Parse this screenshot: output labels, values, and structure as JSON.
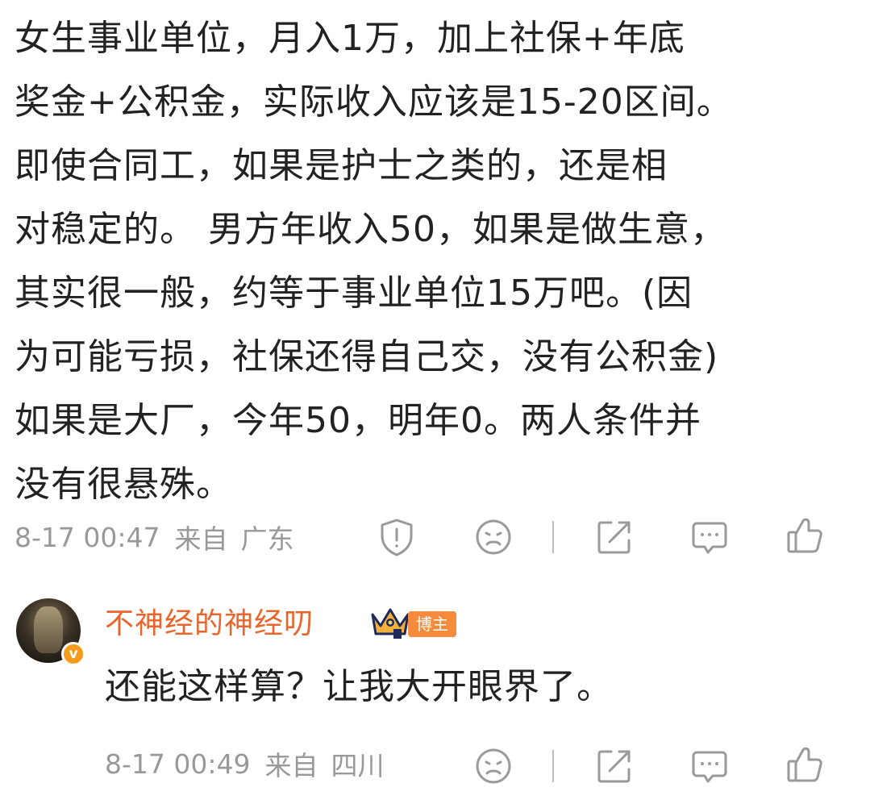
{
  "comment": {
    "lines": [
      "女生事业单位，月入1万，加上社保+年底",
      "奖金+公积金，实际收入应该是15-20区间。",
      "即使合同工，如果是护士之类的，还是相",
      "对稳定的。 男方年收入50，如果是做生意，",
      "其实很一般，约等于事业单位15万吧。(因",
      "为可能亏损，社保还得自己交，没有公积金)",
      "如果是大厂，今年50，明年0。两人条件并",
      "没有很悬殊。"
    ],
    "timestamp": "8-17 00:47",
    "source": "来自",
    "location": "广东"
  },
  "reply": {
    "username": "不神经的神经叨",
    "badge": "博主",
    "verified_mark": "v",
    "text": "还能这样算？让我大开眼界了。",
    "timestamp": "8-17 00:49",
    "source": "来自",
    "location": "四川"
  },
  "icons": {
    "report": "report-icon",
    "dislike": "dislike-icon",
    "share": "share-icon",
    "comment": "comment-icon",
    "like": "like-icon"
  },
  "colors": {
    "text": "#222222",
    "meta": "#999999",
    "username": "#e8662c",
    "badge_bg": "#f58b3c",
    "verify": "#f59b1c"
  }
}
